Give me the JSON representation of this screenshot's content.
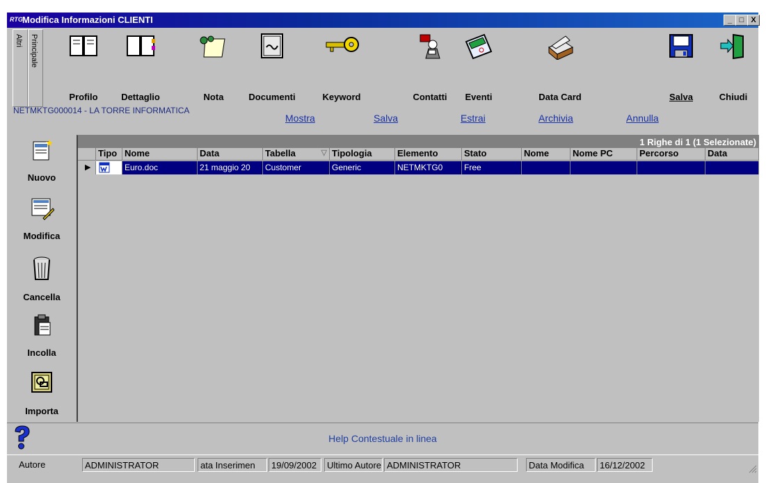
{
  "window": {
    "logo": "RTG",
    "title": "Modifica Informazioni CLIENTI",
    "controls": {
      "minimize": "_",
      "maximize": "□",
      "close": "X"
    }
  },
  "side_tabs": {
    "altri": "Altri",
    "principale": "Principale"
  },
  "toolbar": {
    "profilo": "Profilo",
    "dettaglio": "Dettaglio",
    "nota": "Nota",
    "documenti": "Documenti",
    "keyword": "Keyword",
    "contatti": "Contatti",
    "eventi": "Eventi",
    "data_card": "Data Card",
    "salva": "Salva",
    "chiudi": "Chiudi"
  },
  "record": {
    "id_label": "NETMKTG000014 - LA TORRE INFORMATICA"
  },
  "actions": {
    "mostra": "Mostra",
    "salva": "Salva",
    "estrai": "Estrai",
    "archivia": "Archivia",
    "annulla": "Annulla"
  },
  "left_buttons": {
    "nuovo": "Nuovo",
    "modifica": "Modifica",
    "cancella": "Cancella",
    "incolla": "Incolla",
    "importa": "Importa"
  },
  "grid": {
    "count": "1 Righe di 1  (1 Selezionate)",
    "columns": [
      "Tipo",
      "Nome",
      "Data",
      "Tabella",
      "Tipologia",
      "Elemento",
      "Stato",
      "Nome",
      "Nome PC",
      "Percorso",
      "Data"
    ],
    "rows": [
      {
        "nome": "Euro.doc",
        "data": "21 maggio 20",
        "tabella": "Customer",
        "tipologia": "Generic",
        "elemento": "NETMKTG0",
        "stato": "Free"
      }
    ]
  },
  "help": {
    "text": "Help Contestuale in linea"
  },
  "status": {
    "autore_label": "Autore",
    "autore_value": "ADMINISTRATOR",
    "data_ins_label": "ata Inserimen",
    "data_ins_value": "19/09/2002",
    "ultimo_autore_label": "Ultimo Autore",
    "ultimo_autore_value": "ADMINISTRATOR",
    "data_mod_label": "Data Modifica",
    "data_mod_value": "16/12/2002"
  }
}
